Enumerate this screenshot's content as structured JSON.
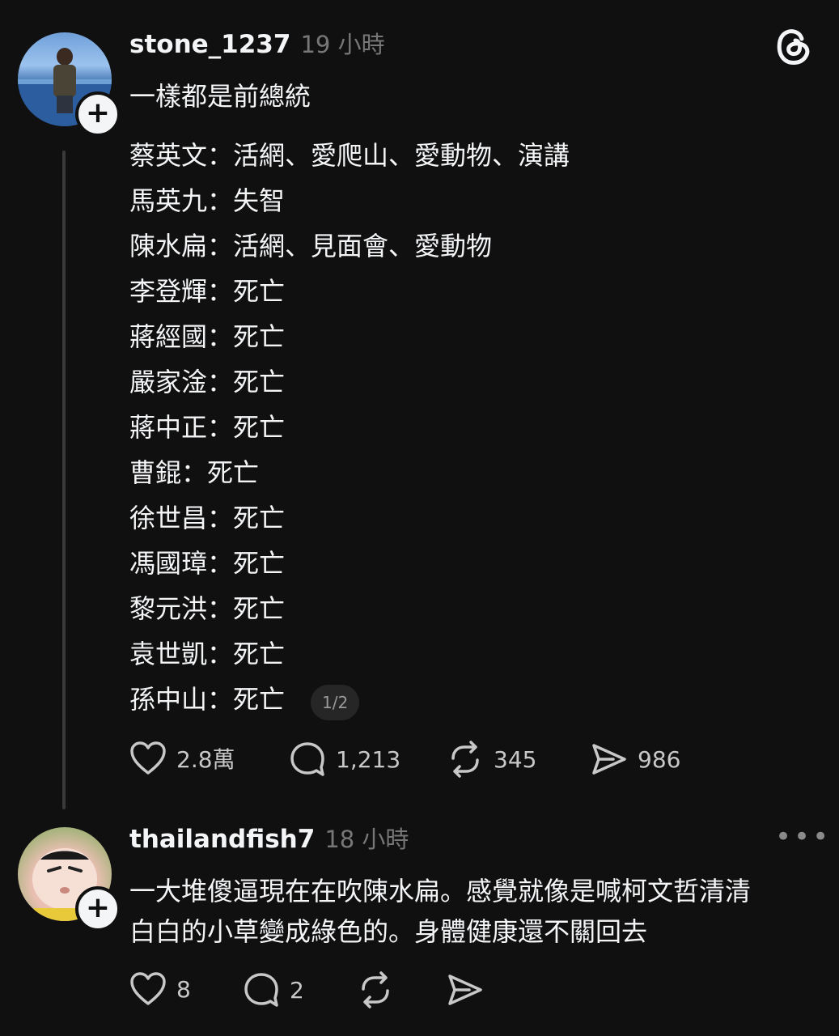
{
  "post": {
    "username": "stone_1237",
    "timestamp": "19 小時",
    "headline": "一樣都是前總統",
    "lines": [
      "蔡英文：活網、愛爬山、愛動物、演講",
      "馬英九：失智",
      "陳水扁：活網、見面會、愛動物",
      "李登輝：死亡",
      "蔣經國：死亡",
      "嚴家淦：死亡",
      "蔣中正：死亡",
      "曹錕：死亡",
      "徐世昌：死亡",
      "馮國璋：死亡",
      "黎元洪：死亡",
      "袁世凱：死亡",
      "孫中山：死亡"
    ],
    "page_counter": "1/2",
    "likes": "2.8萬",
    "comments": "1,213",
    "reposts": "345",
    "shares": "986"
  },
  "reply": {
    "username": "thailandfish7",
    "timestamp": "18 小時",
    "text_line1": "一大堆傻逼現在在吹陳水扁。感覺就像是喊柯文哲清清",
    "text_line2": "白白的小草變成綠色的。身體健康還不關回去",
    "likes": "8",
    "comments": "2"
  },
  "icons": {
    "app_logo": "threads-logo-icon",
    "like": "heart-icon",
    "comment": "comment-bubble-icon",
    "repost": "repost-icon",
    "share": "send-icon",
    "more": "more-options-icon",
    "follow": "plus-icon"
  },
  "colors": {
    "background": "#101010",
    "text": "#f3f5f7",
    "muted": "#777777"
  }
}
